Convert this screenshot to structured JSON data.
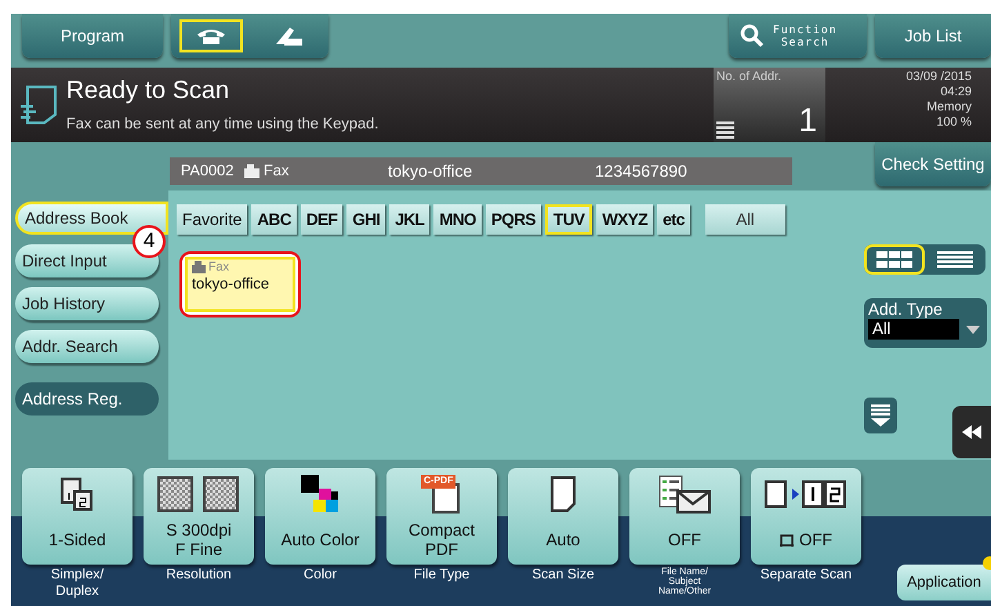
{
  "top_bar": {
    "program_button": "Program",
    "mode_tabs": [
      {
        "kind": "phone",
        "selected": true
      },
      {
        "kind": "onhook",
        "selected": false
      }
    ],
    "function_search": [
      "Function",
      "Search"
    ],
    "job_list": "Job List"
  },
  "status": {
    "title": "Ready to Scan",
    "message": "Fax can be sent at any time using the Keypad.",
    "addr_label": "No. of Addr.",
    "addr_count": "1",
    "date": "03/09 /2015",
    "time": "04:29",
    "memory_label": "Memory",
    "memory_value": "100 %"
  },
  "destination": {
    "id": "PA0002",
    "type": "Fax",
    "name": "tokyo-office",
    "number": "1234567890"
  },
  "check_setting": "Check Setting",
  "side_nav": [
    {
      "label": "Address Book",
      "kind": "tab",
      "selected": true
    },
    {
      "label": "Direct Input",
      "kind": "tab",
      "selected": false
    },
    {
      "label": "Job History",
      "kind": "tab",
      "selected": false
    },
    {
      "label": "Addr. Search",
      "kind": "tab",
      "selected": false
    },
    {
      "label": "Address Reg.",
      "kind": "action"
    }
  ],
  "index_tabs": [
    {
      "label": "Favorite",
      "kind": "plain",
      "selected": false
    },
    {
      "label": "ABC",
      "kind": "letters",
      "selected": false
    },
    {
      "label": "DEF",
      "kind": "letters",
      "selected": false
    },
    {
      "label": "GHI",
      "kind": "letters",
      "selected": false
    },
    {
      "label": "JKL",
      "kind": "letters",
      "selected": false
    },
    {
      "label": "MNO",
      "kind": "letters",
      "selected": false
    },
    {
      "label": "PQRS",
      "kind": "letters",
      "selected": false
    },
    {
      "label": "TUV",
      "kind": "letters",
      "selected": true
    },
    {
      "label": "WXYZ",
      "kind": "letters",
      "selected": false
    },
    {
      "label": "etc",
      "kind": "letters",
      "selected": false
    },
    {
      "label": "All",
      "kind": "all",
      "selected": false
    }
  ],
  "entries": [
    {
      "type": "Fax",
      "name": "tokyo-office",
      "selected": true
    }
  ],
  "callout": "4",
  "view_toggle": [
    {
      "kind": "grid",
      "selected": true
    },
    {
      "kind": "list",
      "selected": false
    }
  ],
  "add_type": {
    "label": "Add. Type",
    "value": "All"
  },
  "settings": [
    {
      "kind": "sides",
      "value": [
        "1-Sided"
      ],
      "label": [
        "Simplex/",
        "Duplex"
      ]
    },
    {
      "kind": "resolution",
      "value": [
        "S 300dpi",
        "F Fine"
      ],
      "label": [
        "Resolution"
      ]
    },
    {
      "kind": "color",
      "value": [
        "Auto Color"
      ],
      "label": [
        "Color"
      ]
    },
    {
      "kind": "pdf",
      "value": [
        "Compact",
        "PDF"
      ],
      "label": [
        "File Type"
      ]
    },
    {
      "kind": "page",
      "value": [
        "Auto"
      ],
      "label": [
        "Scan Size"
      ]
    },
    {
      "kind": "mail",
      "value": [
        "OFF"
      ],
      "label": [
        "File Name/",
        "Subject",
        "Name/Other"
      ]
    },
    {
      "kind": "separate",
      "value": [
        "OFF"
      ],
      "label": [
        "Separate Scan"
      ]
    }
  ],
  "pdf_badge": "C-PDF",
  "application": "Application"
}
